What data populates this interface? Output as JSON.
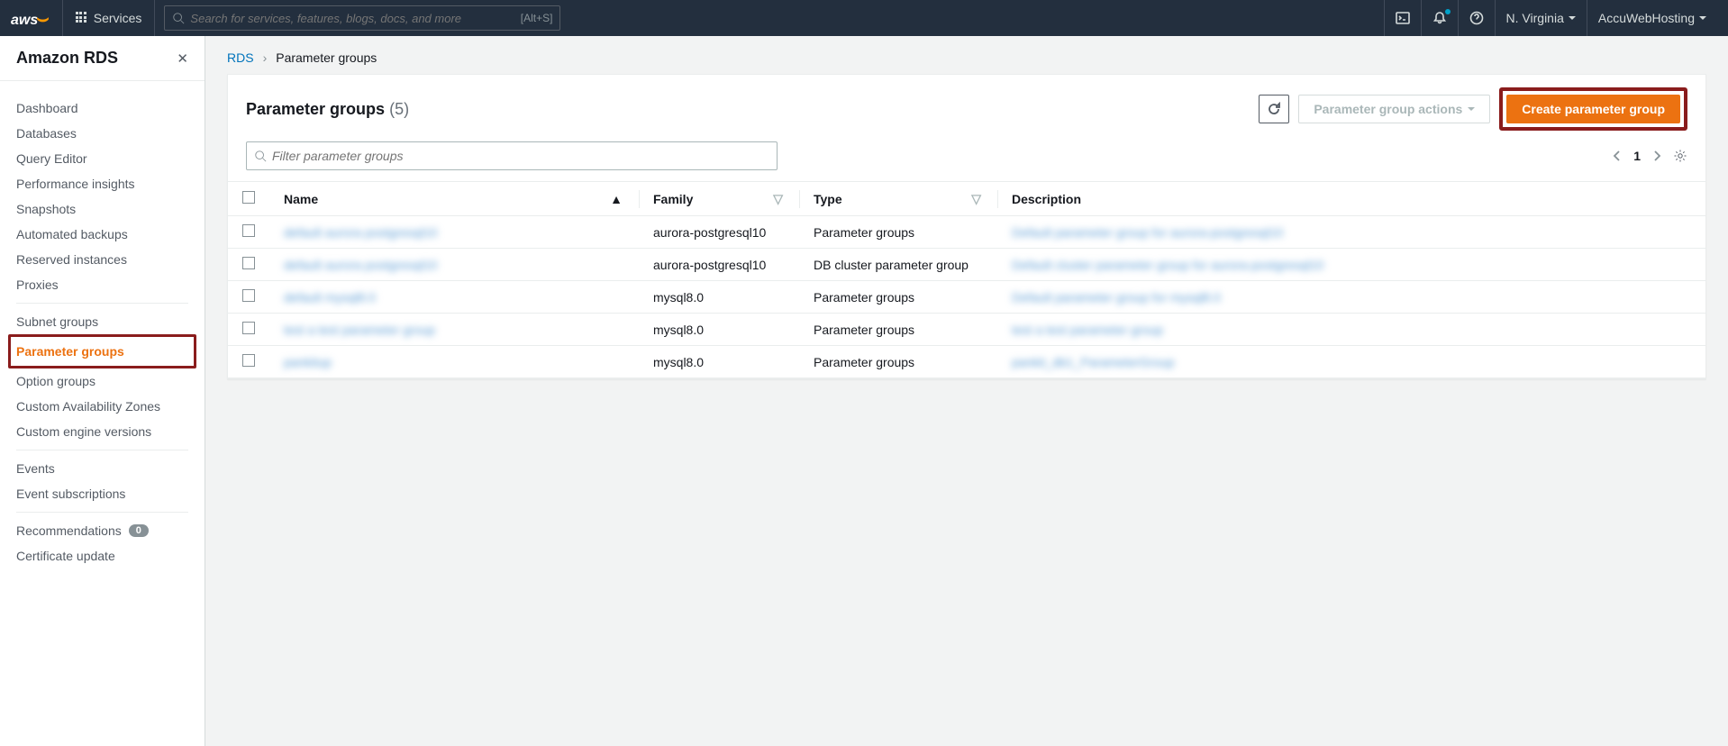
{
  "topnav": {
    "services": "Services",
    "search_placeholder": "Search for services, features, blogs, docs, and more",
    "search_hint": "[Alt+S]",
    "region": "N. Virginia",
    "account": "AccuWebHosting"
  },
  "sidebar": {
    "title": "Amazon RDS",
    "groups": [
      {
        "items": [
          "Dashboard",
          "Databases",
          "Query Editor",
          "Performance insights",
          "Snapshots",
          "Automated backups",
          "Reserved instances",
          "Proxies"
        ]
      },
      {
        "items": [
          "Subnet groups",
          "Parameter groups",
          "Option groups",
          "Custom Availability Zones",
          "Custom engine versions"
        ],
        "active_index": 1
      },
      {
        "items": [
          "Events",
          "Event subscriptions"
        ]
      },
      {
        "items_badged": [
          {
            "label": "Recommendations",
            "badge": "0"
          },
          {
            "label": "Certificate update"
          }
        ]
      }
    ]
  },
  "crumbs": {
    "root": "RDS",
    "current": "Parameter groups"
  },
  "panel": {
    "title": "Parameter groups",
    "count": "(5)",
    "actions_label": "Parameter group actions",
    "create_label": "Create parameter group",
    "filter_placeholder": "Filter parameter groups",
    "page": "1",
    "columns": [
      "Name",
      "Family",
      "Type",
      "Description"
    ],
    "rows": [
      {
        "name": "default aurora postgresql10",
        "family": "aurora-postgresql10",
        "type": "Parameter groups",
        "desc": "Default parameter group for aurora-postgresql10"
      },
      {
        "name": "default aurora postgresql10",
        "family": "aurora-postgresql10",
        "type": "DB cluster parameter group",
        "desc": "Default cluster parameter group for aurora-postgresql10"
      },
      {
        "name": "default mysql8.0",
        "family": "mysql8.0",
        "type": "Parameter groups",
        "desc": "Default parameter group for mysql8.0"
      },
      {
        "name": "test a test parameter group",
        "family": "mysql8.0",
        "type": "Parameter groups",
        "desc": "test a test parameter group"
      },
      {
        "name": "pankitup",
        "family": "mysql8.0",
        "type": "Parameter groups",
        "desc": "pankit_db1_ParameterGroup"
      }
    ]
  }
}
